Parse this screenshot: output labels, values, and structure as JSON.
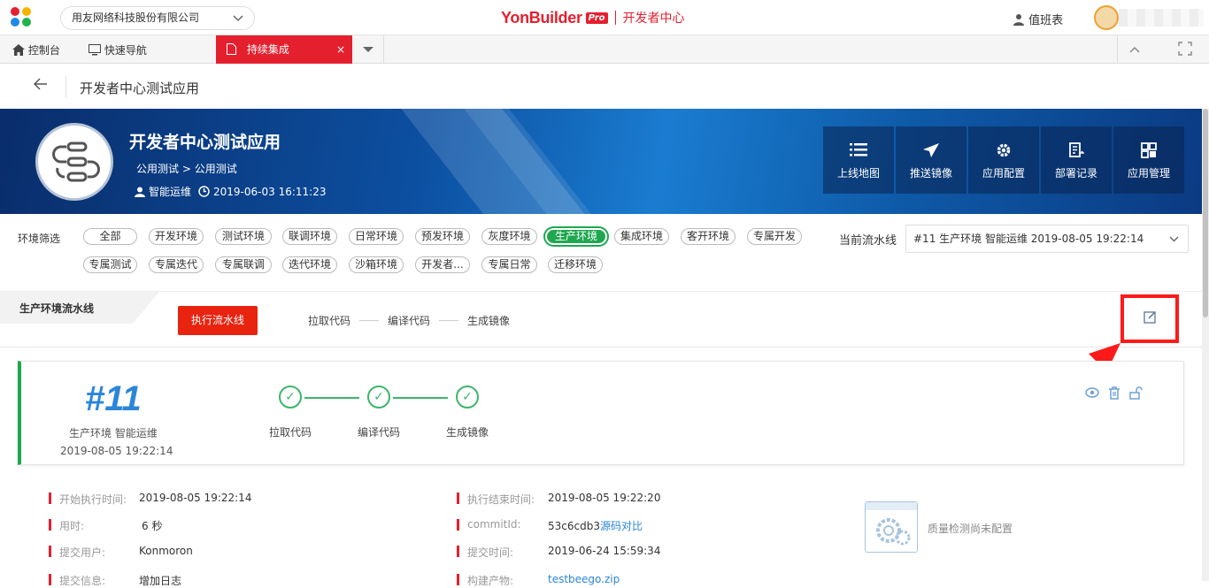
{
  "topbar": {
    "org_name": "用友网络科技股份有限公司",
    "brand": "YonBuilder",
    "brand_badge": "Pro",
    "product": "开发者中心",
    "duty": "值班表"
  },
  "tabs": {
    "home": "控制台",
    "nav": "快速导航",
    "active": "持续集成",
    "close": "×"
  },
  "page": {
    "title": "开发者中心测试应用"
  },
  "app": {
    "name": "开发者中心测试应用",
    "path_1": "公用测试",
    "path_sep": ">",
    "path_2": "公用测试",
    "owner": "智能运维",
    "created": "2019-06-03 16:11:23",
    "actions": [
      "上线地图",
      "推送镜像",
      "应用配置",
      "部署记录",
      "应用管理"
    ]
  },
  "env_filter": {
    "label": "环境筛选",
    "row1": [
      "全部",
      "开发环境",
      "测试环境",
      "联调环境",
      "日常环境",
      "预发环境",
      "灰度环境",
      "生产环境",
      "集成环境",
      "客开环境",
      "专属开发"
    ],
    "row2": [
      "专属测试",
      "专属迭代",
      "专属联调",
      "迭代环境",
      "沙箱环境",
      "开发者...",
      "专属日常",
      "迁移环境"
    ],
    "active": "生产环境",
    "pipeline_label": "当前流水线",
    "pipeline_value": "#11 生产环境 智能运维 2019-08-05 19:22:14"
  },
  "pipeline": {
    "tab": "生产环境流水线",
    "run_button": "执行流水线",
    "steps": [
      "拉取代码",
      "编译代码",
      "生成镜像"
    ]
  },
  "build": {
    "number": "#11",
    "env": "生产环境 智能运维",
    "time": "2019-08-05 19:22:14",
    "stages": [
      "拉取代码",
      "编译代码",
      "生成镜像"
    ]
  },
  "details": {
    "start_label": "开始执行时间:",
    "start_value": "2019-08-05 19:22:14",
    "duration_label": "用时:",
    "duration_value": "6 秒",
    "user_label": "提交用户:",
    "user_value": "Konmoron",
    "info_label": "提交信息:",
    "info_value": "增加日志",
    "end_label": "执行结束时间:",
    "end_value": "2019-08-05 19:22:20",
    "commit_label": "commitId:",
    "commit_value": "53c6cdb3",
    "commit_link": "源码对比",
    "commit_time_label": "提交时间:",
    "commit_time_value": "2019-06-24 15:59:34",
    "artifact_label": "构建产物:",
    "artifact_value": "testbeego.zip",
    "quality_text": "质量检测尚未配置"
  }
}
